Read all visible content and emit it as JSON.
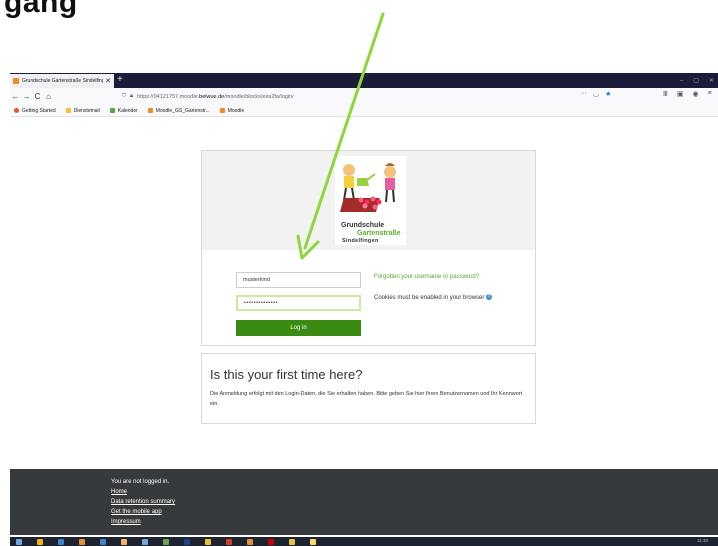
{
  "annotation": {
    "heading": "gang"
  },
  "browser": {
    "tab_title": "Grundschule Gartenstraße Sindelfingen",
    "tab_close": "✕",
    "new_tab": "+",
    "window_controls": [
      "–",
      "▢",
      "✕"
    ],
    "nav": {
      "back": "←",
      "forward": "→",
      "reload": "C",
      "home": "⌂"
    },
    "url_prefix": "https://04121757.moodle.",
    "url_domain": "belwue.de",
    "url_path": "/moodle/blocks/exa2fa/login/",
    "url_menu": "···",
    "bookmarks": [
      {
        "label": "Getting Started",
        "color": "#e25a1c"
      },
      {
        "label": "Dienstemail",
        "color": "#f2c230"
      },
      {
        "label": "Kalender",
        "color": "#56a83a"
      },
      {
        "label": "Moodle_GS_Gartenstr...",
        "color": "#f08a24"
      },
      {
        "label": "Moodle",
        "color": "#f08a24"
      }
    ]
  },
  "logo": {
    "line1": "Grundschule",
    "line2": "Gartenstraße",
    "line3": "Sindelfingen"
  },
  "login": {
    "username_value": "musterkind",
    "password_value": "••••••••••••••",
    "button_label": "Log in",
    "forgot_link": "Forgotten your username or password?",
    "cookies_notice": "Cookies must be enabled in your browser",
    "help_icon": "?"
  },
  "first_time": {
    "heading": "Is this your first time here?",
    "text": "Die Anmeldung erfolgt mit den Login-Daten, die Sie erhalten haben. Bitte geben Sie hier Ihren Benutzernamen und Ihr Kennwort ein."
  },
  "footer": {
    "not_logged_in": "You are not logged in.",
    "links": [
      "Home",
      "Data retention summary",
      "Get the mobile app",
      "Impressum"
    ]
  },
  "taskbar": {
    "clock": "11:30",
    "icon_colors": [
      "#6fa8dc",
      "#f4b400",
      "#3d85c6",
      "#e69138",
      "#3d85c6",
      "#f6b26b",
      "#6fa8dc",
      "#6aa84f",
      "#1c4587",
      "#f1c232",
      "#cc4125",
      "#e69138",
      "#cc0000",
      "#f1c232",
      "#ffd966"
    ]
  },
  "colors": {
    "accent_green": "#3b8a12",
    "link_green": "#5aa830",
    "footer_bg": "#373a3c",
    "arrow": "#8ed63a"
  }
}
